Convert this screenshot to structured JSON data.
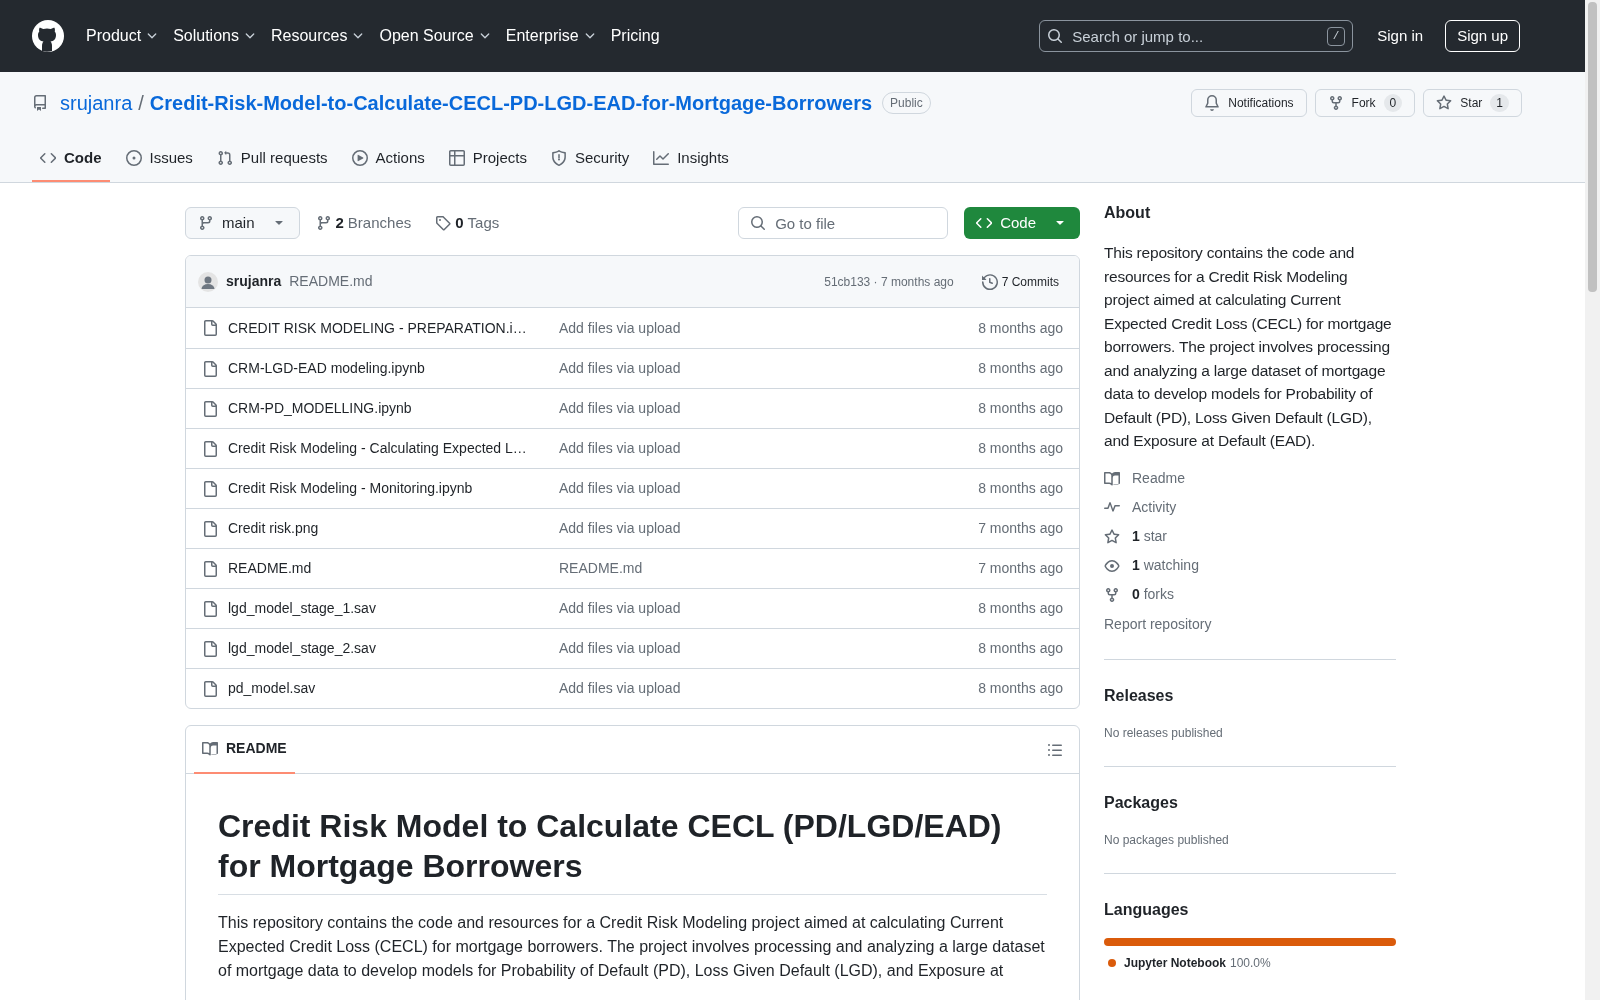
{
  "header": {
    "nav": [
      {
        "label": "Product",
        "dropdown": true
      },
      {
        "label": "Solutions",
        "dropdown": true
      },
      {
        "label": "Resources",
        "dropdown": true
      },
      {
        "label": "Open Source",
        "dropdown": true
      },
      {
        "label": "Enterprise",
        "dropdown": true
      },
      {
        "label": "Pricing",
        "dropdown": false
      }
    ],
    "search": {
      "placeholder": "Search or jump to...",
      "key": "/"
    },
    "sign_in": "Sign in",
    "sign_up": "Sign up"
  },
  "repo": {
    "owner": "srujanra",
    "separator": "/",
    "name": "Credit-Risk-Model-to-Calculate-CECL-PD-LGD-EAD-for-Mortgage-Borrowers",
    "visibility": "Public",
    "notifications": "Notifications",
    "fork": {
      "label": "Fork",
      "count": "0"
    },
    "star": {
      "label": "Star",
      "count": "1"
    }
  },
  "tabs": [
    {
      "kind": "code",
      "label": "Code",
      "selected": true
    },
    {
      "kind": "issues",
      "label": "Issues",
      "selected": false
    },
    {
      "kind": "pulls",
      "label": "Pull requests",
      "selected": false
    },
    {
      "kind": "actions",
      "label": "Actions",
      "selected": false
    },
    {
      "kind": "projects",
      "label": "Projects",
      "selected": false
    },
    {
      "kind": "security",
      "label": "Security",
      "selected": false
    },
    {
      "kind": "insights",
      "label": "Insights",
      "selected": false
    }
  ],
  "toolbar": {
    "branch": "main",
    "branches": {
      "count": "2",
      "label": "Branches"
    },
    "tags": {
      "count": "0",
      "label": "Tags"
    },
    "go_to_file": {
      "placeholder": "Go to file"
    },
    "code_button": "Code"
  },
  "commit": {
    "author": "srujanra",
    "message": "README.md",
    "hash_time": "51cb133 · 7 months ago",
    "commits": "7 Commits"
  },
  "files": [
    {
      "name": "CREDIT RISK MODELING - PREPARATION.i…",
      "message": "Add files via upload",
      "time": "8 months ago"
    },
    {
      "name": "CRM-LGD-EAD modeling.ipynb",
      "message": "Add files via upload",
      "time": "8 months ago"
    },
    {
      "name": "CRM-PD_MODELLING.ipynb",
      "message": "Add files via upload",
      "time": "8 months ago"
    },
    {
      "name": "Credit Risk Modeling - Calculating Expected L…",
      "message": "Add files via upload",
      "time": "8 months ago"
    },
    {
      "name": "Credit Risk Modeling - Monitoring.ipynb",
      "message": "Add files via upload",
      "time": "8 months ago"
    },
    {
      "name": "Credit risk.png",
      "message": "Add files via upload",
      "time": "7 months ago"
    },
    {
      "name": "README.md",
      "message": "README.md",
      "time": "7 months ago"
    },
    {
      "name": "lgd_model_stage_1.sav",
      "message": "Add files via upload",
      "time": "8 months ago"
    },
    {
      "name": "lgd_model_stage_2.sav",
      "message": "Add files via upload",
      "time": "8 months ago"
    },
    {
      "name": "pd_model.sav",
      "message": "Add files via upload",
      "time": "8 months ago"
    }
  ],
  "readme": {
    "tab": "README",
    "title": "Credit Risk Model to Calculate CECL (PD/LGD/EAD) for Mortgage Borrowers",
    "paragraph": "This repository contains the code and resources for a Credit Risk Modeling project aimed at calculating Current Expected Credit Loss (CECL) for mortgage borrowers. The project involves processing and analyzing a large dataset of mortgage data to develop models for Probability of Default (PD), Loss Given Default (LGD), and Exposure at"
  },
  "sidebar": {
    "about": {
      "heading": "About",
      "description": "This repository contains the code and resources for a Credit Risk Modeling project aimed at calculating Current Expected Credit Loss (CECL) for mortgage borrowers. The project involves processing and analyzing a large dataset of mortgage data to develop models for Probability of Default (PD), Loss Given Default (LGD), and Exposure at Default (EAD).",
      "links": [
        {
          "kind": "readme",
          "label": "Readme"
        },
        {
          "kind": "activity",
          "label": "Activity"
        },
        {
          "kind": "star",
          "count": "1",
          "label": "star"
        },
        {
          "kind": "watch",
          "count": "1",
          "label": "watching"
        },
        {
          "kind": "fork",
          "count": "0",
          "label": "forks"
        }
      ],
      "report": "Report repository"
    },
    "releases": {
      "heading": "Releases",
      "note": "No releases published"
    },
    "packages": {
      "heading": "Packages",
      "note": "No packages published"
    },
    "languages": {
      "heading": "Languages",
      "items": [
        {
          "name": "Jupyter Notebook",
          "percent": "100.0%",
          "color": "#da5b0b",
          "level": 1
        }
      ]
    }
  }
}
